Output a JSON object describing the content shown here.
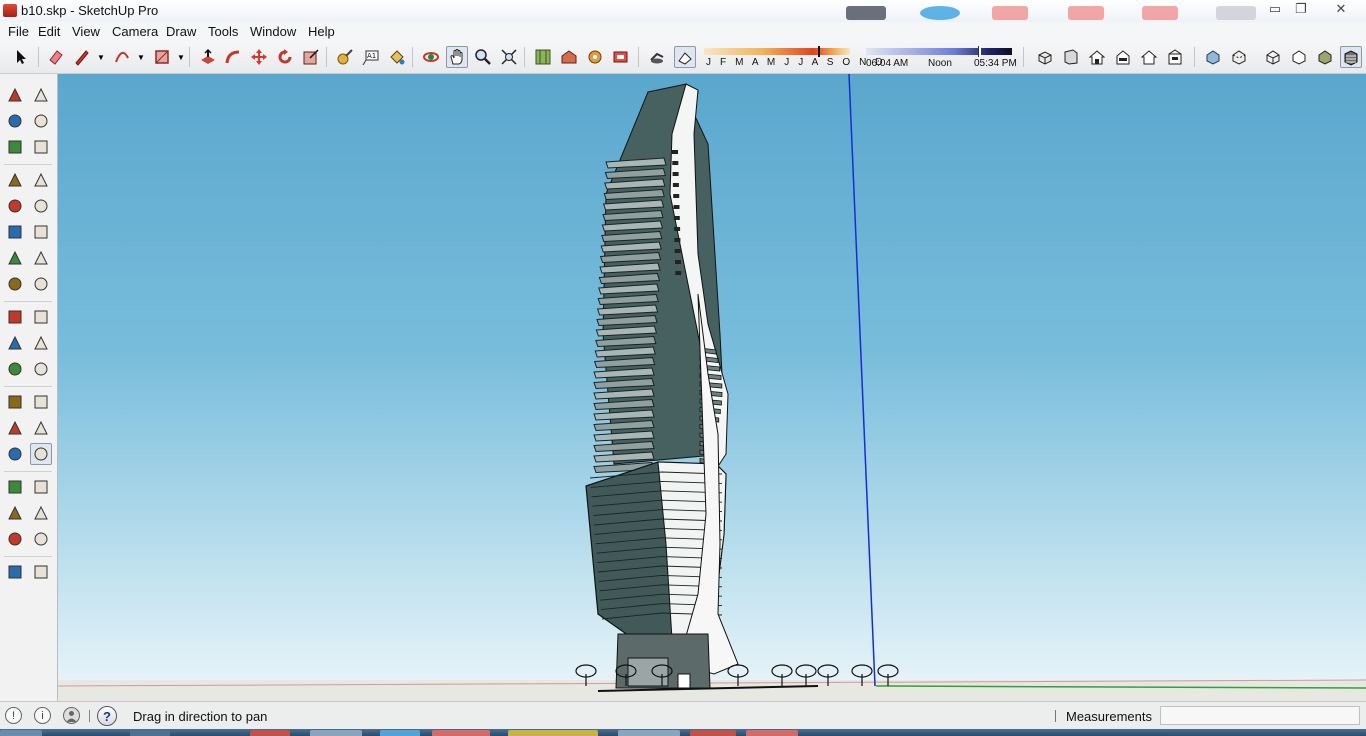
{
  "window": {
    "title": "b10.skp - SketchUp Pro",
    "minimize_glyph": "▭",
    "restore_glyph": "❐",
    "close_glyph": "✕"
  },
  "menu": [
    "File",
    "Edit",
    "View",
    "Camera",
    "Draw",
    "Tools",
    "Window",
    "Help"
  ],
  "toolbar": {
    "tools": [
      {
        "name": "select-tool",
        "icon": "arrow-icon"
      },
      {
        "name": "eraser-tool",
        "icon": "eraser-icon"
      },
      {
        "name": "line-tool",
        "icon": "pencil-icon",
        "dropdown": true
      },
      {
        "name": "arc-tool",
        "icon": "arc-icon",
        "dropdown": true
      },
      {
        "name": "shape-tool",
        "icon": "rectangle-icon",
        "dropdown": true
      },
      {
        "name": "push-pull-tool",
        "icon": "push-pull-icon"
      },
      {
        "name": "follow-me-tool",
        "icon": "follow-me-icon"
      },
      {
        "name": "move-tool",
        "icon": "move-icon"
      },
      {
        "name": "rotate-tool",
        "icon": "rotate-icon"
      },
      {
        "name": "scale-tool",
        "icon": "scale-icon"
      },
      {
        "name": "tape-measure-tool",
        "icon": "tape-icon"
      },
      {
        "name": "text-tool",
        "icon": "text-icon"
      },
      {
        "name": "paint-bucket-tool",
        "icon": "paint-bucket-icon"
      },
      {
        "name": "orbit-tool",
        "icon": "orbit-icon"
      },
      {
        "name": "pan-tool",
        "icon": "hand-icon",
        "active": true
      },
      {
        "name": "zoom-tool",
        "icon": "magnifier-icon"
      },
      {
        "name": "zoom-extents-tool",
        "icon": "zoom-extents-icon"
      },
      {
        "name": "previous-view-tool",
        "icon": "map-icon"
      },
      {
        "name": "warehouse-tool",
        "icon": "warehouse-icon"
      },
      {
        "name": "extension-warehouse-tool",
        "icon": "extension-icon"
      },
      {
        "name": "layout-tool",
        "icon": "layout-icon"
      },
      {
        "name": "shadows-toggle",
        "icon": "shadow-icon"
      },
      {
        "name": "fog-toggle",
        "icon": "fog-icon",
        "active": true
      }
    ],
    "months": "J F M A M J J A S O N D",
    "month_position": 0.78,
    "time_start": "06:04 AM",
    "time_noon": "Noon",
    "time_end": "05:34 PM",
    "time_position": 0.77,
    "view_tools": [
      "iso-view-icon",
      "top-view-icon",
      "front-view-icon",
      "right-view-icon",
      "back-view-icon",
      "left-view-icon"
    ],
    "style_tools": [
      "xray-icon",
      "back-edges-icon",
      "wireframe-icon",
      "hidden-line-icon",
      "shaded-icon",
      "shaded-textures-icon"
    ]
  },
  "palette": [
    [
      "select-icon",
      "component-icon"
    ],
    [
      "paint-bucket-icon",
      "eraser-icon"
    ],
    [
      "line-icon",
      "freehand-icon"
    ],
    [
      "rectangle-icon",
      "rotated-rectangle-icon"
    ],
    [
      "circle-icon",
      "polygon-icon"
    ],
    [
      "arc-icon",
      "two-point-arc-icon"
    ],
    [
      "three-point-arc-icon",
      "pie-icon"
    ],
    [
      "move-icon",
      "push-pull-icon"
    ],
    [
      "rotate-icon",
      "follow-me-icon"
    ],
    [
      "scale-icon",
      "offset-icon"
    ],
    [
      "tape-measure-icon",
      "dimension-icon"
    ],
    [
      "protractor-icon",
      "text-icon"
    ],
    [
      "axes-icon",
      "3d-text-icon"
    ],
    [
      "orbit-icon",
      "pan-icon"
    ],
    [
      "zoom-icon",
      "zoom-window-icon"
    ],
    [
      "zoom-extents-icon",
      "position-camera-icon"
    ],
    [
      "walk-icon",
      "look-around-icon"
    ],
    [
      "footprints-icon",
      "section-plane-icon"
    ]
  ],
  "status": {
    "hint": "Drag in direction to pan",
    "measurements_label": "Measurements",
    "measurements_value": "",
    "help_glyph": "?",
    "geo_glyph": "!",
    "credits_glyph": "i"
  },
  "colors": {
    "sky_top": "#5aa7cd",
    "axis_blue": "#1a2bd6",
    "axis_green": "#1d9e2a",
    "axis_red": "#cc2a2a",
    "glass": "#3f5d5c"
  }
}
